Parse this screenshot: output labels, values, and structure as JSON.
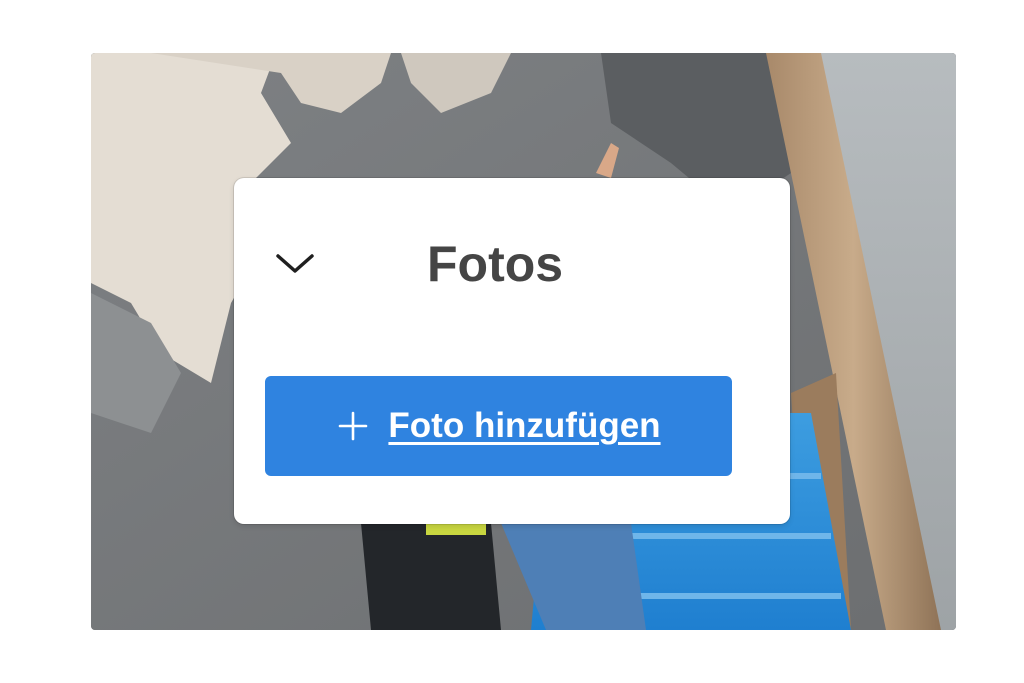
{
  "card": {
    "title": "Fotos",
    "toggle_icon": "chevron-down-icon",
    "add_button": {
      "icon": "plus-icon",
      "label": "Foto hinzufügen"
    }
  },
  "background_photo": {
    "subject": "construction-site-photo"
  },
  "colors": {
    "button": "#2f83e0",
    "title": "#454545",
    "card": "#ffffff"
  }
}
